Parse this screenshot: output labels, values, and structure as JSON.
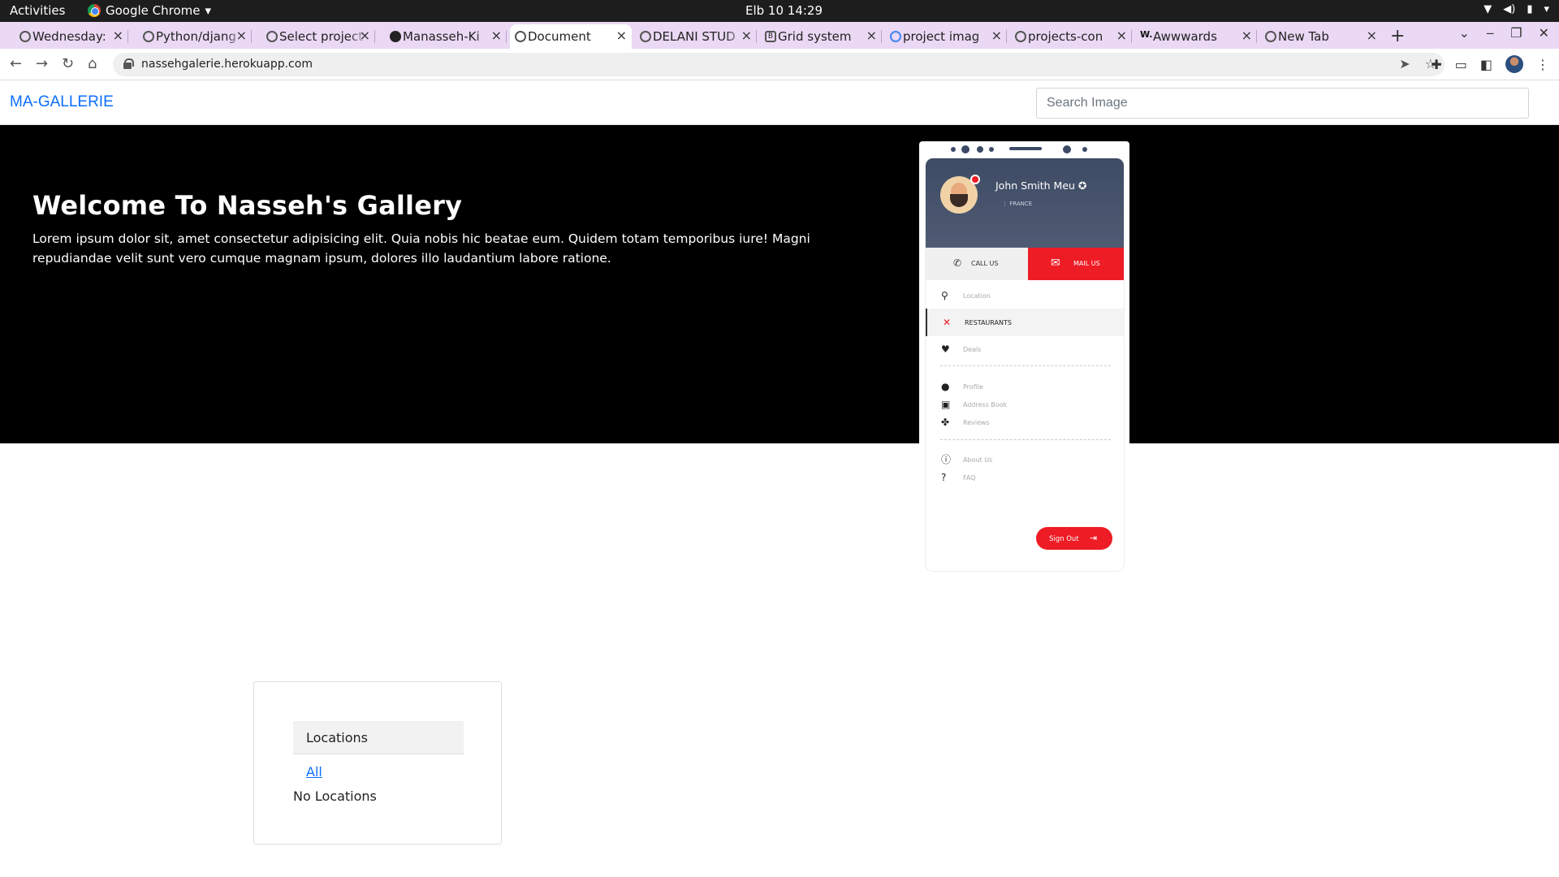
{
  "system_bar": {
    "activities": "Activities",
    "app_name": "Google Chrome",
    "clock": "Elb 10  14:29"
  },
  "browser": {
    "tabs": [
      {
        "title": "Wednesday:",
        "active": false
      },
      {
        "title": "Python/djang",
        "active": false
      },
      {
        "title": "Select project",
        "active": false
      },
      {
        "title": "Manasseh-Ki",
        "active": false
      },
      {
        "title": "Document",
        "active": true
      },
      {
        "title": "DELANI STUD",
        "active": false
      },
      {
        "title": "Grid system",
        "active": false
      },
      {
        "title": "project imag",
        "active": false
      },
      {
        "title": "projects-con",
        "active": false
      },
      {
        "title": "Awwwards",
        "active": false
      },
      {
        "title": "New Tab",
        "active": false
      }
    ],
    "url": "nassehgalerie.herokuapp.com"
  },
  "page": {
    "brand": "MA-GALLERIE",
    "search_placeholder": "Search Image",
    "hero": {
      "title": "Welcome To Nasseh's Gallery",
      "text": "Lorem ipsum dolor sit, amet consectetur adipisicing elit. Quia nobis hic beatae eum. Quidem totam temporibus iure! Magni repudiandae velit sunt vero cumque magnam ipsum, dolores illo laudantium labore ratione."
    },
    "phone": {
      "name": "John Smith Meu",
      "country": "FRANCE",
      "call_label": "CALL US",
      "mail_label": "MAIL US",
      "menu": [
        "Location",
        "RESTAURANTS",
        "Deals",
        "Profile",
        "Address Book",
        "Reviews",
        "About Us",
        "FAQ"
      ],
      "sign_out": "Sign Out"
    },
    "locations": {
      "header": "Locations",
      "all_link": "All",
      "empty": "No Locations"
    }
  },
  "colors": {
    "accent": "#0d6efd",
    "hero_bg": "#000000",
    "tab_strip": "#ead8f4",
    "phone_red": "#ee1c25",
    "phone_header": "#3e4b64"
  }
}
